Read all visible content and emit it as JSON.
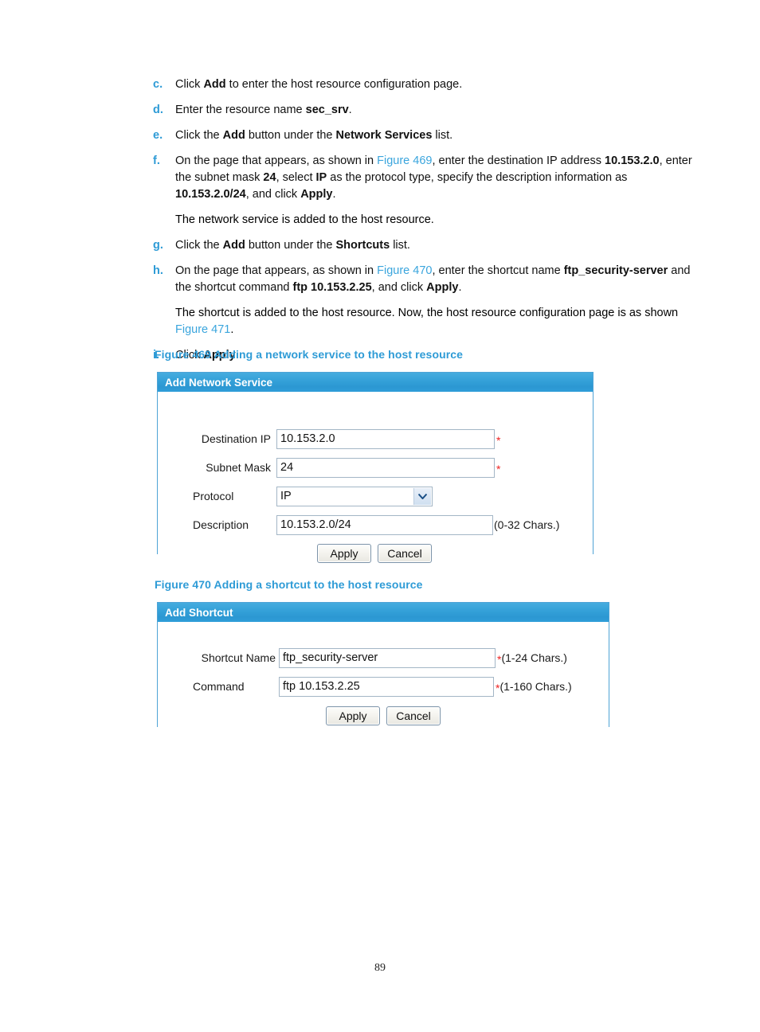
{
  "document": {
    "page_number": "89"
  },
  "procedure": {
    "steps": [
      {
        "marker": "c.",
        "parts": [
          {
            "t": "Click ",
            "b": false
          },
          {
            "t": "Add",
            "b": true
          },
          {
            "t": " to enter the host resource configuration page.",
            "b": false
          }
        ]
      },
      {
        "marker": "d.",
        "parts": [
          {
            "t": "Enter the resource name ",
            "b": false
          },
          {
            "t": "sec_srv",
            "b": true
          },
          {
            "t": ".",
            "b": false
          }
        ]
      },
      {
        "marker": "e.",
        "parts": [
          {
            "t": "Click the ",
            "b": false
          },
          {
            "t": "Add",
            "b": true
          },
          {
            "t": " button under the ",
            "b": false
          },
          {
            "t": "Network Services",
            "b": true
          },
          {
            "t": " list.",
            "b": false
          }
        ]
      },
      {
        "marker": "f.",
        "parts": [
          {
            "t": "On the page that appears, as shown in ",
            "b": false
          },
          {
            "t": "Figure 469",
            "b": false,
            "x": true
          },
          {
            "t": ", enter the destination IP address ",
            "b": false
          },
          {
            "t": "10.153.2.0",
            "b": true
          },
          {
            "t": ", enter the subnet mask ",
            "b": false
          },
          {
            "t": "24",
            "b": true
          },
          {
            "t": ", select ",
            "b": false
          },
          {
            "t": "IP",
            "b": true
          },
          {
            "t": " as the protocol type, specify the description information as ",
            "b": false
          },
          {
            "t": "10.153.2.0/24",
            "b": true
          },
          {
            "t": ", and click ",
            "b": false
          },
          {
            "t": "Apply",
            "b": true
          },
          {
            "t": ".",
            "b": false
          }
        ]
      }
    ],
    "note_after_f": "The network service is added to the host resource.",
    "steps2": [
      {
        "marker": "g.",
        "parts": [
          {
            "t": "Click the ",
            "b": false
          },
          {
            "t": "Add",
            "b": true
          },
          {
            "t": " button under the ",
            "b": false
          },
          {
            "t": "Shortcuts",
            "b": true
          },
          {
            "t": " list.",
            "b": false
          }
        ]
      },
      {
        "marker": "h.",
        "parts": [
          {
            "t": "On the page that appears, as shown in ",
            "b": false
          },
          {
            "t": "Figure 470",
            "b": false,
            "x": true
          },
          {
            "t": ", enter the shortcut name ",
            "b": false
          },
          {
            "t": "ftp_security-server",
            "b": true
          },
          {
            "t": " and the shortcut command ",
            "b": false
          },
          {
            "t": "ftp 10.153.2.25",
            "b": true
          },
          {
            "t": ", and click ",
            "b": false
          },
          {
            "t": "Apply",
            "b": true
          },
          {
            "t": ".",
            "b": false
          }
        ]
      }
    ],
    "note_after_h": [
      {
        "t": "The shortcut is added to the host resource. Now, the host resource configuration page is as shown ",
        "b": false
      },
      {
        "t": "Figure 471",
        "b": false,
        "x": true
      },
      {
        "t": ".",
        "b": false
      }
    ],
    "steps3": [
      {
        "marker": "i.",
        "parts": [
          {
            "t": "Click ",
            "b": false
          },
          {
            "t": "Apply",
            "b": true
          },
          {
            "t": ".",
            "b": false
          }
        ]
      }
    ]
  },
  "figure469": {
    "caption": "Figure 469 Adding a network service to the host resource",
    "dialog_title": "Add Network Service",
    "fields": {
      "destination_ip": {
        "label": "Destination IP",
        "value": "10.153.2.0",
        "required_mark": "*"
      },
      "subnet_mask": {
        "label": "Subnet Mask",
        "value": "24",
        "required_mark": "*"
      },
      "protocol": {
        "label": "Protocol",
        "value": "IP",
        "options": [
          "IP"
        ]
      },
      "description": {
        "label": "Description",
        "value": "10.153.2.0/24",
        "hint": "(0-32 Chars.)"
      }
    },
    "buttons": {
      "apply": "Apply",
      "cancel": "Cancel"
    }
  },
  "figure470": {
    "caption": "Figure 470 Adding a shortcut to the host resource",
    "dialog_title": "Add Shortcut",
    "fields": {
      "shortcut_name": {
        "label": "Shortcut Name",
        "value": "ftp_security-server",
        "required_mark": "*",
        "hint": "(1-24 Chars.)"
      },
      "command": {
        "label": "Command",
        "value": "ftp 10.153.2.25",
        "required_mark": "*",
        "hint": "(1-160 Chars.)"
      }
    },
    "buttons": {
      "apply": "Apply",
      "cancel": "Cancel"
    }
  },
  "colors": {
    "accent_blue": "#2e9bd6",
    "xref_blue": "#3aa5dd",
    "dialog_border": "#4ea3d6",
    "required_red": "#ee2222"
  }
}
